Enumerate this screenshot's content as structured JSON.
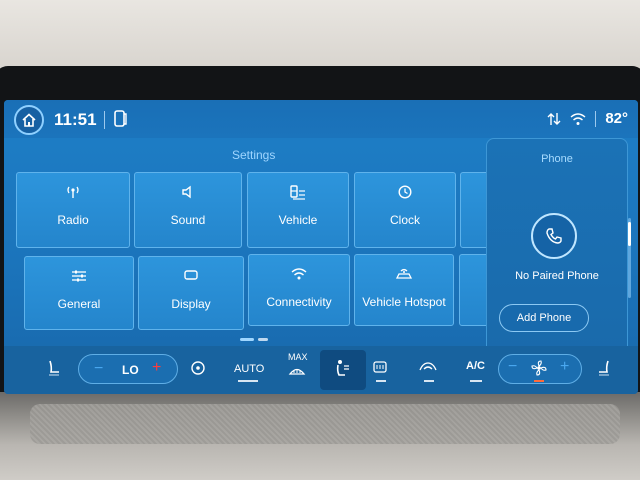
{
  "status": {
    "time": "11:51",
    "temperature": "82°"
  },
  "settings": {
    "title": "Settings",
    "tiles": [
      {
        "label": "Radio",
        "icon": "radio-antenna-icon"
      },
      {
        "label": "Sound",
        "icon": "speaker-icon"
      },
      {
        "label": "Vehicle",
        "icon": "vehicle-settings-icon"
      },
      {
        "label": "Clock",
        "icon": "clock-icon"
      },
      {
        "label": "General",
        "icon": "sliders-icon"
      },
      {
        "label": "Display",
        "icon": "display-icon"
      },
      {
        "label": "Connectivity",
        "icon": "wifi-icon"
      },
      {
        "label": "Vehicle Hotspot",
        "icon": "hotspot-icon"
      }
    ]
  },
  "phone": {
    "title": "Phone",
    "status": "No Paired Phone",
    "add_label": "Add Phone"
  },
  "climate": {
    "left_temp": "LO",
    "auto_label": "AUTO",
    "max_label": "MAX",
    "ac_label": "A/C",
    "minus": "−",
    "plus": "+"
  },
  "colors": {
    "screen_blue": "#1e7fc7",
    "tile_blue": "#2a8fd6",
    "accent_light": "#9fd6ff",
    "minus_blue": "#4aa8f0",
    "plus_red": "#ff3b3b"
  }
}
